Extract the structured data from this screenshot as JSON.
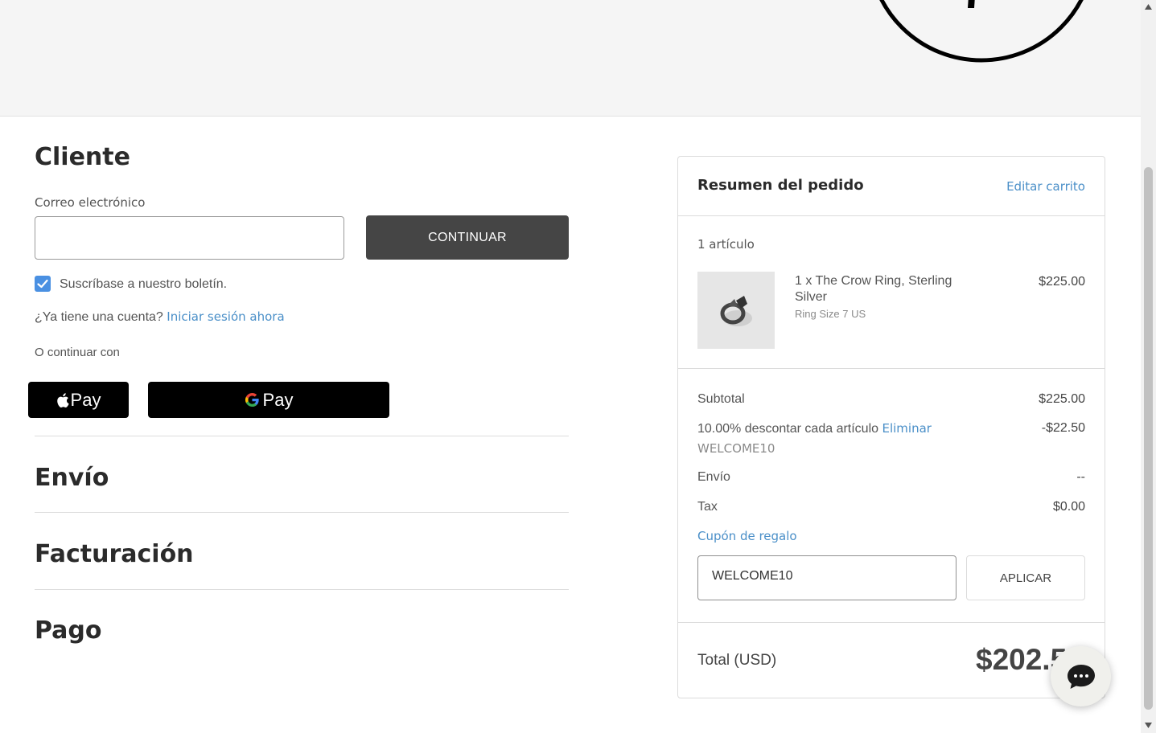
{
  "customer": {
    "title": "Cliente",
    "email_label": "Correo electrónico",
    "email_value": "",
    "continue_label": "CONTINUAR",
    "newsletter_label": "Suscríbase a nuestro boletín.",
    "newsletter_checked": true,
    "account_prompt": "¿Ya tiene una cuenta?",
    "signin_link": "Iniciar sesión ahora",
    "or_continue": "O continuar con",
    "apple_pay_label": "Pay",
    "google_pay_label": "Pay"
  },
  "sections": {
    "shipping": "Envío",
    "billing": "Facturación",
    "payment": "Pago"
  },
  "summary": {
    "title": "Resumen del pedido",
    "edit_cart": "Editar carrito",
    "item_count": "1 artículo",
    "item": {
      "name": "1 x The Crow Ring, Sterling Silver",
      "option": "Ring Size 7 US",
      "price": "$225.00"
    },
    "subtotal_label": "Subtotal",
    "subtotal_value": "$225.00",
    "discount_label": "10.00% descontar cada artículo",
    "discount_remove": "Eliminar",
    "discount_code": "WELCOME10",
    "discount_value": "-$22.50",
    "shipping_label": "Envío",
    "shipping_value": "--",
    "tax_label": "Tax",
    "tax_value": "$0.00",
    "gift_coupon_label": "Cupón de regalo",
    "coupon_value": "WELCOME10",
    "apply_label": "APLICAR",
    "total_label": "Total (USD)",
    "total_value": "$202.50"
  },
  "colors": {
    "accent_link": "#4a8fc8",
    "checkbox": "#4a90e2",
    "continue_button": "#454545"
  }
}
